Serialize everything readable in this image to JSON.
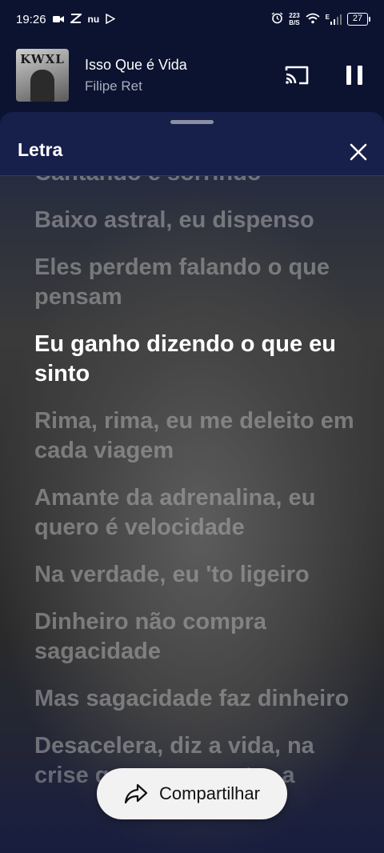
{
  "status_bar": {
    "time": "19:26",
    "left_icons": [
      "video-icon",
      "app-icon",
      "nu-icon",
      "play-store-icon"
    ],
    "nu_label": "nu",
    "net_speed_value": "223",
    "net_speed_unit": "B/S",
    "signal_label": "E",
    "battery_level": "27"
  },
  "mini_player": {
    "album_art_text": "KWXL",
    "track_title": "Isso Que é Vida",
    "artist": "Filipe Ret",
    "cast_icon": "cast-icon",
    "pause_icon": "pause-icon"
  },
  "lyrics_sheet": {
    "title": "Letra",
    "close_icon": "close-icon",
    "lines": [
      "Cantando e sorrindo",
      "Baixo astral, eu dispenso",
      "Eles perdem falando o que pensam",
      "Eu ganho dizendo o que eu sinto",
      "Rima, rima, eu me deleito em cada viagem",
      "Amante da adrenalina, eu quero é velocidade",
      "Na verdade, eu 'to ligeiro",
      "Dinheiro não compra sagacidade",
      "Mas sagacidade faz dinheiro",
      "Desacelera, diz a vida, na crise que eu encontro a"
    ],
    "active_index": 3
  },
  "share_button": {
    "label": "Compartilhar",
    "icon": "share-icon"
  },
  "colors": {
    "background": "#0b1330",
    "header": "#16204a",
    "active_lyric": "#ffffff",
    "inactive_lyric": "#afafaf",
    "share_button": "#f2f2f2"
  }
}
